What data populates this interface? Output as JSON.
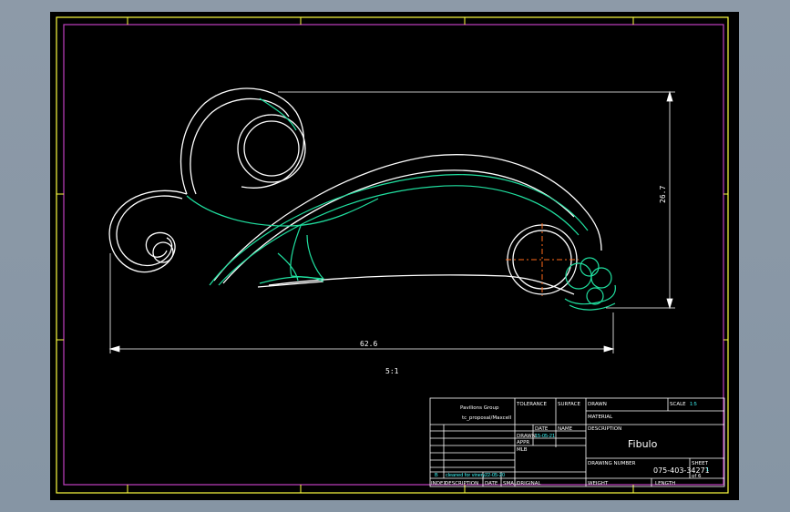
{
  "drawing": {
    "dimensions": {
      "width": "62.6",
      "height": "26.7",
      "view_scale": "5:1"
    }
  },
  "title_block": {
    "company": "Pavilions Group",
    "file": "tc_proposal/Maxcell",
    "tolerance_label": "TOLERANCE",
    "surface_label": "SURFACE",
    "drawn_label": "DRAWN",
    "scale_label": "SCALE",
    "scale_value": "1:5",
    "material_label": "MATERIAL",
    "date_header": "DATE",
    "name_header": "NAME",
    "row_drawn": "DRAWN",
    "row_drawn_date": "15-05-21",
    "row_appr": "APPR",
    "row_mlb": "MLB",
    "description_label": "DESCRIPTION",
    "description": "Fibulo",
    "drawing_number_label": "DRAWING NUMBER",
    "drawing_number": "075-403-34271",
    "sheet_label": "SHEET",
    "sheet_no": "1",
    "sheet_of": "of 6",
    "weight_label": "WEIGHT",
    "length_label": "LENGTH",
    "revision": {
      "index": "B",
      "note": "cleaned for vinery",
      "date": "22-05-20"
    },
    "columns": {
      "index": "INDEX",
      "description": "DESCRIPTION",
      "date": "DATE",
      "small": "SMALL",
      "original": "ORIGINAL"
    }
  },
  "colors": {
    "frame_magenta": "#c040c0",
    "frame_yellow": "#ffff40",
    "geometry_white": "#ffffff",
    "geometry_green": "#20e0a0",
    "centerline_orange": "#ff6a1a",
    "text_cyan": "#40ffff"
  }
}
